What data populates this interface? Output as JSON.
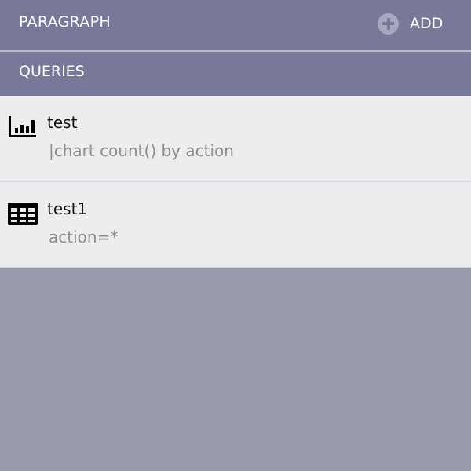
{
  "paragraph": {
    "title": "PARAGRAPH",
    "add_label": "ADD"
  },
  "queries": {
    "title": "QUERIES",
    "items": [
      {
        "name": "test",
        "query": "|chart count() by action",
        "icon": "bar-chart-icon"
      },
      {
        "name": "test1",
        "query": "action=*",
        "icon": "table-grid-icon"
      }
    ]
  },
  "colors": {
    "header_bg": "#787899",
    "item_bg": "#ededf0",
    "empty_bg": "#9999ac",
    "query_text": "#8c8c8c"
  }
}
